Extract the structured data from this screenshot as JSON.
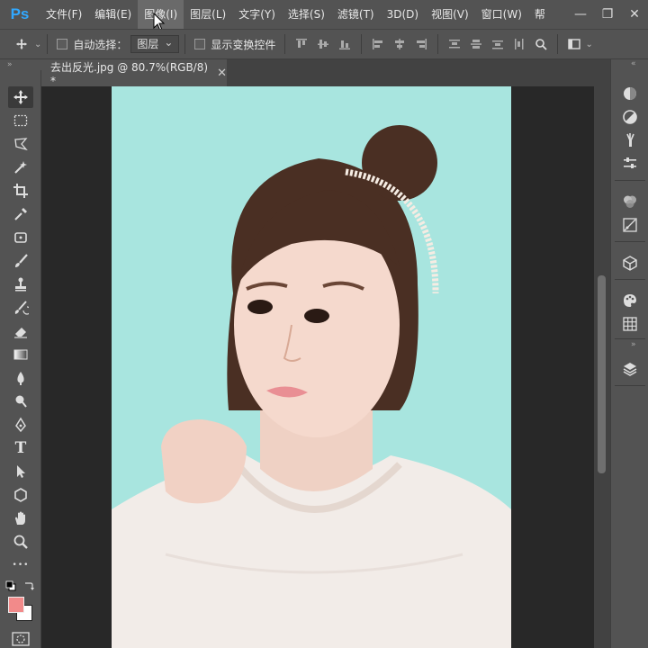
{
  "app": {
    "logo": "Ps"
  },
  "menu": {
    "items": [
      "文件(F)",
      "编辑(E)",
      "图像(I)",
      "图层(L)",
      "文字(Y)",
      "选择(S)",
      "滤镜(T)",
      "3D(D)",
      "视图(V)",
      "窗口(W)",
      "帮"
    ],
    "active_index": 2
  },
  "window_controls": {
    "minimize": "—",
    "restore": "❐",
    "close": "✕"
  },
  "options_bar": {
    "auto_select_label": "自动选择：",
    "auto_select_checked": false,
    "layer_select_value": "图层",
    "show_transform_label": "显示变换控件",
    "show_transform_checked": false
  },
  "document": {
    "tab_title": "去出反光.jpg @ 80.7%(RGB/8) *",
    "close_glyph": "✕"
  },
  "colors": {
    "foreground": "#f28a8a",
    "background": "#ffffff",
    "canvas_bg": "#a3e6df",
    "ui_bg": "#535353",
    "ps_blue": "#31a8ff"
  },
  "tools": [
    "move-tool-icon",
    "marquee-tool-icon",
    "lasso-tool-icon",
    "quick-select-tool-icon",
    "crop-tool-icon",
    "eyedropper-tool-icon",
    "patch-tool-icon",
    "brush-tool-icon",
    "stamp-tool-icon",
    "history-brush-icon",
    "eraser-tool-icon",
    "gradient-tool-icon",
    "blur-tool-icon",
    "dodge-tool-icon",
    "pen-tool-icon",
    "type-tool-icon",
    "path-select-tool-icon",
    "shape-tool-icon",
    "hand-tool-icon",
    "zoom-tool-icon",
    "more-tools-icon"
  ],
  "type_tool_glyph": "T",
  "more_tools_glyph": "•••",
  "panel_icons": [
    "color-panel-icon",
    "adjustments-panel-icon",
    "brushes-panel-icon",
    "properties-panel-icon",
    "channels-panel-icon",
    "paths-panel-icon",
    "3d-panel-icon",
    "swatches-panel-icon",
    "grid-panel-icon",
    "layers-panel-icon"
  ]
}
